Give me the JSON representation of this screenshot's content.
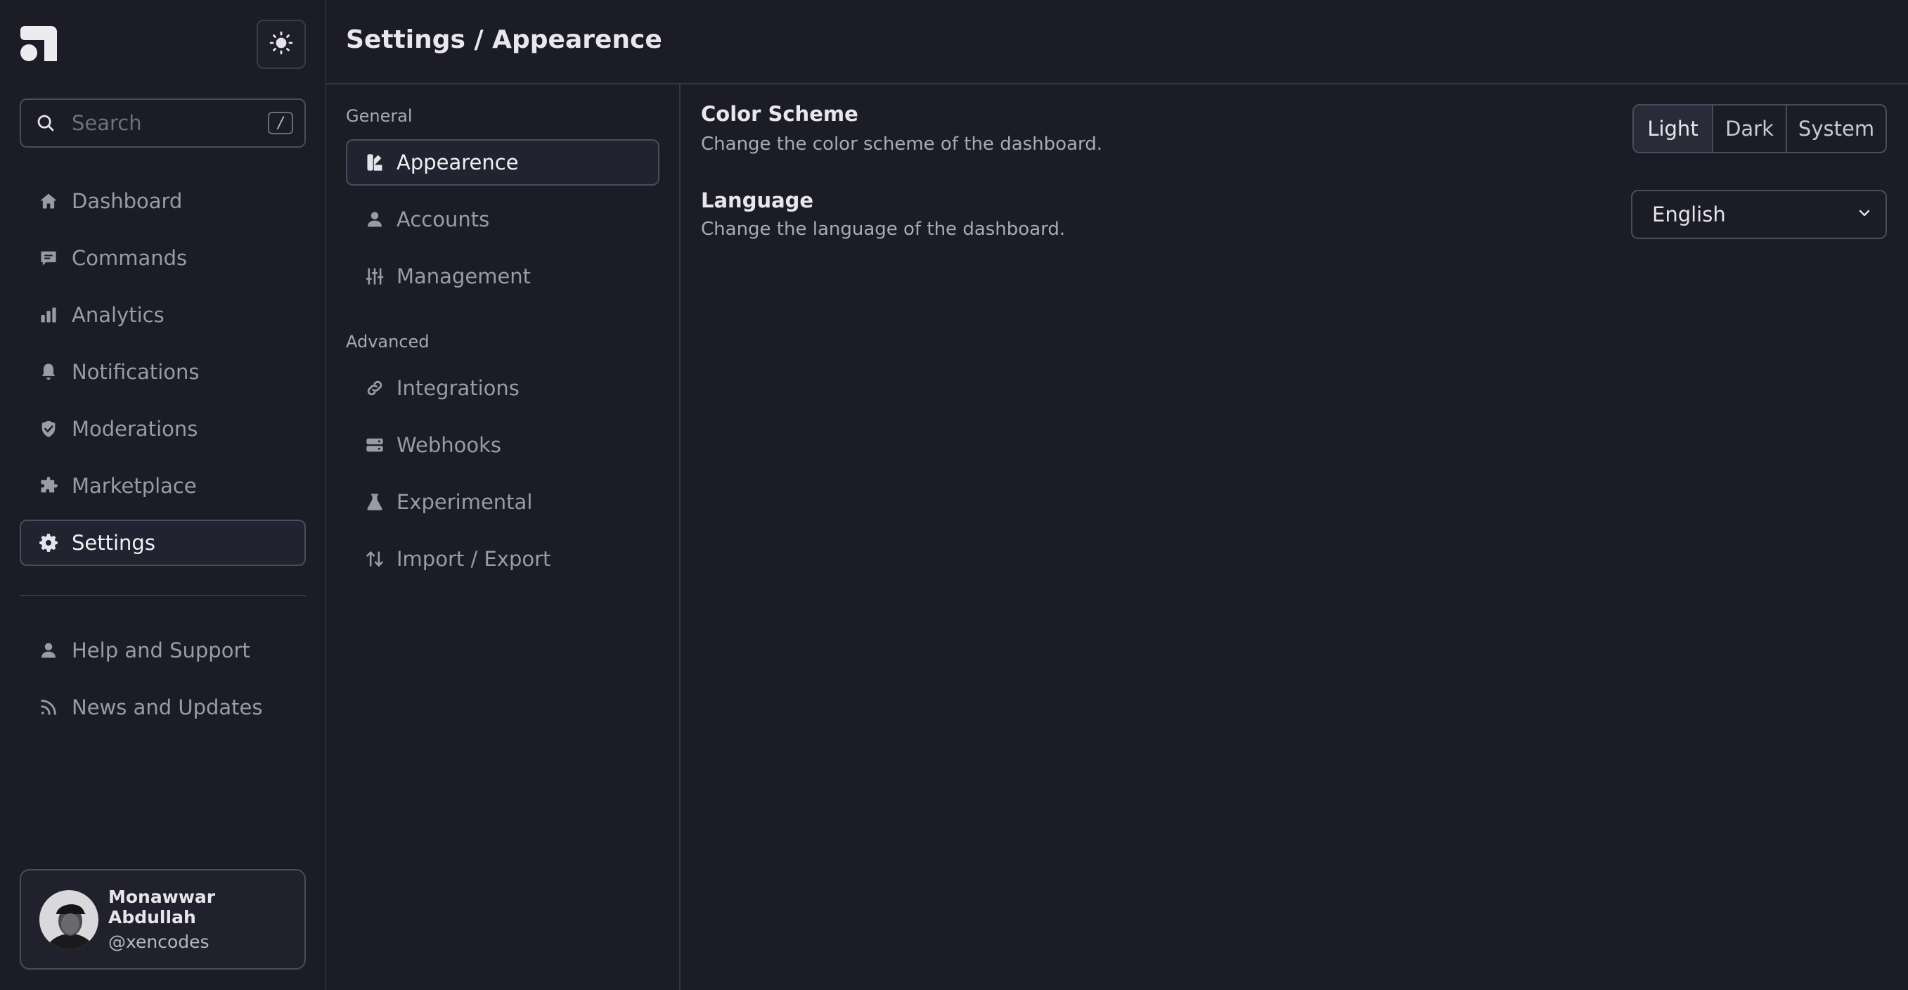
{
  "sidebar": {
    "search": {
      "placeholder": "Search",
      "shortcut": "/"
    },
    "items": [
      {
        "label": "Dashboard",
        "icon": "home-icon"
      },
      {
        "label": "Commands",
        "icon": "message-icon"
      },
      {
        "label": "Analytics",
        "icon": "bar-chart-icon"
      },
      {
        "label": "Notifications",
        "icon": "bell-icon"
      },
      {
        "label": "Moderations",
        "icon": "shield-check-icon"
      },
      {
        "label": "Marketplace",
        "icon": "puzzle-icon"
      },
      {
        "label": "Settings",
        "icon": "gear-icon",
        "active": true
      }
    ],
    "secondary_items": [
      {
        "label": "Help and Support",
        "icon": "user-icon"
      },
      {
        "label": "News and Updates",
        "icon": "rss-icon"
      }
    ],
    "profile": {
      "name": "Monawwar Abdullah",
      "handle": "@xencodes"
    }
  },
  "header": {
    "title": "Settings / Appearence"
  },
  "subnav": {
    "general_label": "General",
    "general_items": [
      {
        "label": "Appearence",
        "icon": "palette-icon",
        "active": true
      },
      {
        "label": "Accounts",
        "icon": "user-icon"
      },
      {
        "label": "Management",
        "icon": "sliders-icon"
      }
    ],
    "advanced_label": "Advanced",
    "advanced_items": [
      {
        "label": "Integrations",
        "icon": "link-icon"
      },
      {
        "label": "Webhooks",
        "icon": "server-icon"
      },
      {
        "label": "Experimental",
        "icon": "flask-icon"
      },
      {
        "label": "Import / Export",
        "icon": "arrows-updown-icon"
      }
    ]
  },
  "content": {
    "color_scheme": {
      "title": "Color Scheme",
      "description": "Change the color scheme of the dashboard.",
      "options": [
        "Light",
        "Dark",
        "System"
      ],
      "selected": "Light"
    },
    "language": {
      "title": "Language",
      "description": "Change the language of the dashboard.",
      "value": "English"
    }
  },
  "colors": {
    "background": "#1b1c26",
    "border": "#4a4c5c",
    "text": "#e4e4e9",
    "muted_text": "#9a9ba6"
  }
}
